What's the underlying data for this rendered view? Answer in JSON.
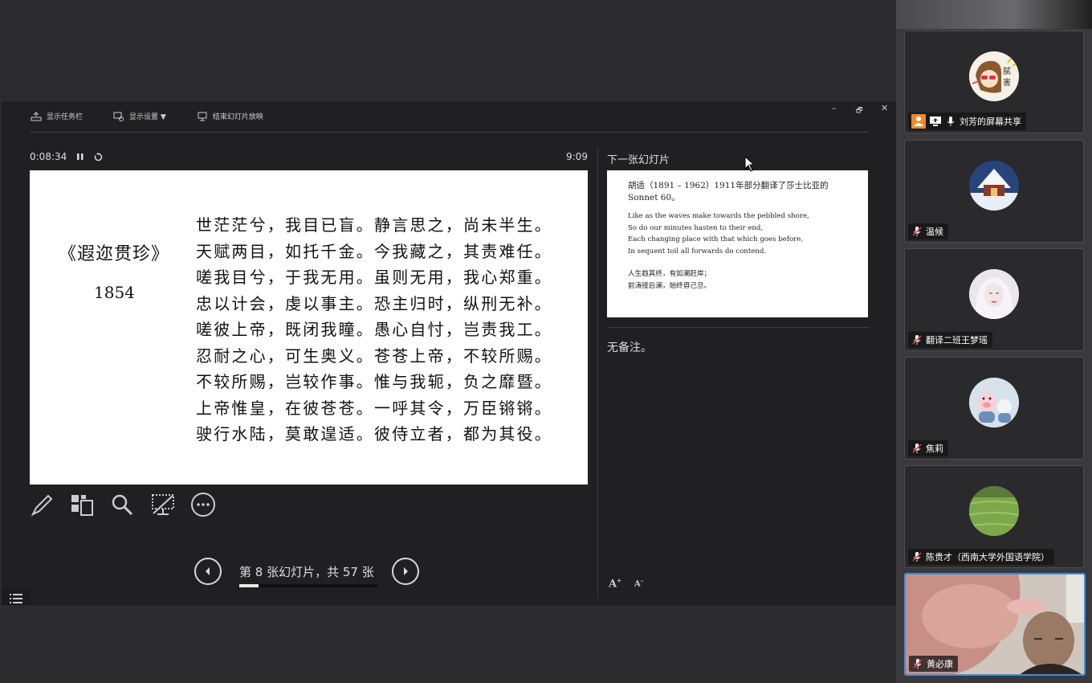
{
  "toolbar": {
    "taskbar_label": "显示任务栏",
    "display_settings_label": "显示设置 ▼",
    "end_show_label": "结束幻灯片放映"
  },
  "window_controls": {
    "minimize": "–",
    "restore": "🗗",
    "close": "✕"
  },
  "timer": {
    "elapsed": "0:08:34",
    "clock": "9:09"
  },
  "current_slide": {
    "title": "《遐迩贯珍》",
    "year": "1854",
    "lines": [
      "世茫茫兮，我目已盲。静言思之，尚未半生。",
      "天赋两目，如托千金。今我藏之，其责难任。",
      "嗟我目兮，于我无用。虽则无用，我心郑重。",
      "忠以计会，虔以事主。恐主归时，纵刑无补。",
      "嗟彼上帝，既闭我瞳。愚心自忖，岂责我工。",
      "忍耐之心，可生奥义。苍苍上帝，不较所赐。",
      "不较所赐，岂较作事。惟与我轭，负之靡暨。",
      "上帝惟皇，在彼苍苍。一呼其令，万臣锵锵。",
      "驶行水陆，莫敢遑适。彼侍立者，都为其役。"
    ]
  },
  "navigation": {
    "counter": "第 8 张幻灯片，共 57 张",
    "progress": 0.14
  },
  "next_slide": {
    "label": "下一张幻灯片",
    "heading": "胡适（1891 – 1962）1911年部分翻译了莎士比亚的Sonnet 60。",
    "english": [
      "Like as the waves make towards the pebbled shore,",
      "So do our minutes hasten to their end,",
      "Each changing place with that which goes before,",
      "In sequent toil all forwards do contend."
    ],
    "chinese": [
      "人生趋其终，有如潮赶岸；",
      "前涛接后澜，始终毋己旦。"
    ]
  },
  "notes": {
    "text": "无备注。"
  },
  "font_controls": {
    "increase": "A",
    "decrease": "A"
  },
  "participants": [
    {
      "name": "刘芳的屏幕共享",
      "sharing": true
    },
    {
      "name": "温候"
    },
    {
      "name": "翻译二班王梦瑶"
    },
    {
      "name": "焦莉"
    },
    {
      "name": "陈贵才（西南大学外国语学院）"
    },
    {
      "name": "黄必康"
    }
  ],
  "avatar_text": "腻害"
}
